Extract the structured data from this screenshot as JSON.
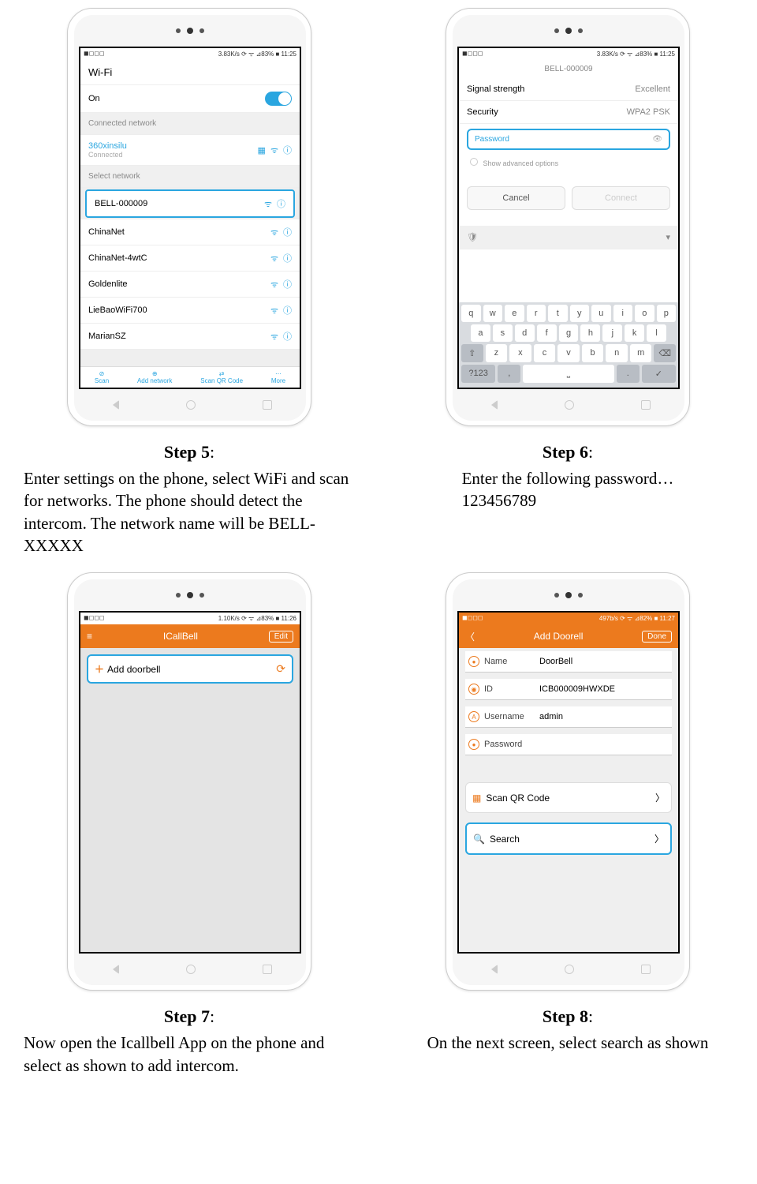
{
  "status_bar": {
    "left_icons": "◼◻◻◻",
    "right": "3.83K/s ⟳ ᯤ ⊿83% ■ 11:25"
  },
  "step5": {
    "title": "Step 5",
    "text": "Enter settings on the phone, select WiFi and scan for networks. The phone should detect the intercom. The network name will be BELL-XXXXX",
    "wifi_title": "Wi-Fi",
    "on_label": "On",
    "connected_header": "Connected network",
    "connected_name": "360xinsilu",
    "connected_sub": "Connected",
    "select_header": "Select network",
    "networks": [
      "BELL-000009",
      "ChinaNet",
      "ChinaNet-4wtC",
      "Goldenlite",
      "LieBaoWiFi700",
      "MarianSZ"
    ],
    "tabs": [
      "Scan",
      "Add network",
      "Scan QR Code",
      "More"
    ]
  },
  "step6": {
    "title": "Step 6",
    "text": "Enter the following password…",
    "password": "123456789",
    "screen_title": "BELL-000009",
    "signal_label": "Signal strength",
    "signal_val": "Excellent",
    "security_label": "Security",
    "security_val": "WPA2 PSK",
    "pw_placeholder": "Password",
    "adv_label": "Show advanced options",
    "cancel": "Cancel",
    "connect": "Connect",
    "keys_r1": [
      "q",
      "w",
      "e",
      "r",
      "t",
      "y",
      "u",
      "i",
      "o",
      "p"
    ],
    "keys_r2": [
      "a",
      "s",
      "d",
      "f",
      "g",
      "h",
      "j",
      "k",
      "l"
    ],
    "keys_r3": [
      "z",
      "x",
      "c",
      "v",
      "b",
      "n",
      "m"
    ]
  },
  "step7": {
    "title": "Step 7",
    "text": "Now open the Icallbell App on the phone and select as shown to add intercom.",
    "status_right": "1.10K/s ⟳ ᯤ ⊿83% ■ 11:26",
    "app_title": "ICallBell",
    "edit": "Edit",
    "add_label": "Add doorbell"
  },
  "step8": {
    "title": "Step 8",
    "text": "On the next screen, select search as shown",
    "status_right": "497b/s ⟳ ᯤ ⊿82% ■ 11:27",
    "app_title": "Add Doorell",
    "done": "Done",
    "name_label": "Name",
    "name_val": "DoorBell",
    "id_label": "ID",
    "id_val": "ICB000009HWXDE",
    "user_label": "Username",
    "user_val": "admin",
    "pw_label": "Password",
    "scan_label": "Scan QR Code",
    "search_label": "Search"
  }
}
